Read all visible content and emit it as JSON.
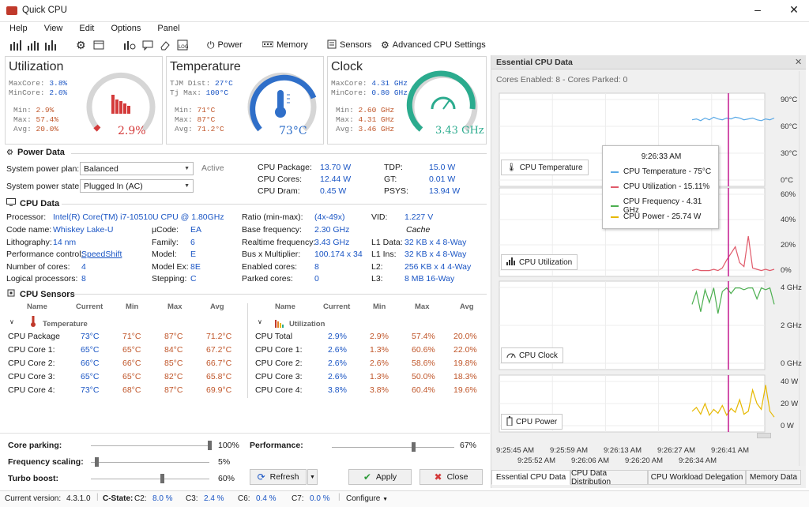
{
  "app": {
    "title": "Quick CPU"
  },
  "menu": [
    "Help",
    "View",
    "Edit",
    "Options",
    "Panel"
  ],
  "toolbar": {
    "power": "Power",
    "memory": "Memory",
    "sensors": "Sensors",
    "advanced": "Advanced CPU Settings"
  },
  "cards": {
    "utilization": {
      "title": "Utilization",
      "rows": [
        [
          "MaxCore:",
          "3.8%"
        ],
        [
          "MinCore:",
          "2.6%"
        ]
      ],
      "stats": [
        [
          "Min:",
          "2.9%"
        ],
        [
          "Max:",
          "57.4%"
        ],
        [
          "Avg:",
          "20.0%"
        ]
      ],
      "value": "2.9%"
    },
    "temperature": {
      "title": "Temperature",
      "rows": [
        [
          "TJM Dist:",
          "27°C"
        ],
        [
          "Tj Max:",
          "100°C"
        ]
      ],
      "stats": [
        [
          "Min:",
          "71°C"
        ],
        [
          "Max:",
          "87°C"
        ],
        [
          "Avg:",
          "71.2°C"
        ]
      ],
      "value": "73°C"
    },
    "clock": {
      "title": "Clock",
      "rows": [
        [
          "MaxCore:",
          "4.31 GHz"
        ],
        [
          "MinCore:",
          "0.80 GHz"
        ]
      ],
      "stats": [
        [
          "Min:",
          "2.60 GHz"
        ],
        [
          "Max:",
          "4.31 GHz"
        ],
        [
          "Avg:",
          "3.46 GHz"
        ]
      ],
      "value": "3.43 GHz"
    }
  },
  "power": {
    "section": "Power Data",
    "plan_label": "System power plan:",
    "plan_value": "Balanced",
    "active": "Active",
    "state_label": "System power state:",
    "state_value": "Plugged In (AC)",
    "metrics": [
      [
        "CPU Package:",
        "13.70 W"
      ],
      [
        "CPU Cores:",
        "12.44 W"
      ],
      [
        "CPU Dram:",
        "0.45 W"
      ]
    ],
    "metrics2": [
      [
        "TDP:",
        "15.0 W"
      ],
      [
        "GT:",
        "0.01 W"
      ],
      [
        "PSYS:",
        "13.94 W"
      ]
    ]
  },
  "cpu": {
    "section": "CPU Data",
    "col1": [
      [
        "Processor:",
        "Intel(R) Core(TM) i7-10510U CPU @ 1.80GHz"
      ],
      [
        "Code name:",
        "Whiskey Lake-U"
      ],
      [
        "Lithography:",
        "14 nm"
      ],
      [
        "Performance control:",
        "SpeedShift"
      ],
      [
        "Number of cores:",
        "4"
      ],
      [
        "Logical processors:",
        "8"
      ]
    ],
    "col2": [
      [
        "µCode:",
        "EA"
      ],
      [
        "Family:",
        "6"
      ],
      [
        "Model:",
        "E"
      ],
      [
        "Model Ex:",
        "8E"
      ],
      [
        "Stepping:",
        "C"
      ]
    ],
    "col3": [
      [
        "Ratio (min-max):",
        "(4x-49x)"
      ],
      [
        "Base frequency:",
        "2.30 GHz"
      ],
      [
        "Realtime frequency:",
        "3.43 GHz"
      ],
      [
        "Bus x Multiplier:",
        "100.174 x 34"
      ],
      [
        "Enabled cores:",
        "8"
      ],
      [
        "Parked cores:",
        "0"
      ]
    ],
    "vid_label": "VID:",
    "vid_value": "1.227 V",
    "cache": "Cache",
    "col4": [
      [
        "L1 Data:",
        "32 KB x 4  8-Way"
      ],
      [
        "L1 Ins:",
        "32 KB x 4  8-Way"
      ],
      [
        "L2:",
        "256 KB x 4  4-Way"
      ],
      [
        "L3:",
        "8 MB  16-Way"
      ]
    ]
  },
  "sensors": {
    "section": "CPU Sensors",
    "headers": [
      "Name",
      "Current",
      "Min",
      "Max",
      "Avg"
    ],
    "temp": {
      "group": "Temperature",
      "rows": [
        [
          "CPU Package",
          "73°C",
          "71°C",
          "87°C",
          "71.2°C"
        ],
        [
          "CPU Core 1:",
          "65°C",
          "65°C",
          "84°C",
          "67.2°C"
        ],
        [
          "CPU Core 2:",
          "66°C",
          "66°C",
          "85°C",
          "66.7°C"
        ],
        [
          "CPU Core 3:",
          "65°C",
          "65°C",
          "82°C",
          "65.8°C"
        ],
        [
          "CPU Core 4:",
          "73°C",
          "68°C",
          "87°C",
          "69.9°C"
        ]
      ]
    },
    "util": {
      "group": "Utilization",
      "rows": [
        [
          "CPU Total",
          "2.9%",
          "2.9%",
          "57.4%",
          "20.0%"
        ],
        [
          "CPU Core 1:",
          "2.6%",
          "1.3%",
          "60.6%",
          "22.0%"
        ],
        [
          "CPU Core 2:",
          "2.6%",
          "2.6%",
          "58.6%",
          "19.8%"
        ],
        [
          "CPU Core 3:",
          "2.6%",
          "1.3%",
          "50.0%",
          "18.3%"
        ],
        [
          "CPU Core 4:",
          "3.8%",
          "3.8%",
          "60.4%",
          "19.6%"
        ]
      ]
    }
  },
  "controls": {
    "core_parking": {
      "label": "Core parking:",
      "value": "100%",
      "level": 1.0
    },
    "freq_scaling": {
      "label": "Frequency scaling:",
      "value": "5%",
      "level": 0.05
    },
    "turbo": {
      "label": "Turbo boost:",
      "value": "60%",
      "level": 0.6
    },
    "performance": {
      "label": "Performance:",
      "value": "67%",
      "level": 0.67
    },
    "refresh": "Refresh",
    "apply": "Apply",
    "close": "Close"
  },
  "panel": {
    "title": "Essential CPU Data",
    "cores": "Cores Enabled: 8 - Cores Parked: 0",
    "tooltip": {
      "time": "9:26:33 AM",
      "items": [
        "CPU Temperature - 75°C",
        "CPU Utilization - 15.11%",
        "CPU Frequency - 4.31 GHz",
        "CPU Power - 25.74 W"
      ],
      "colors": [
        "#5aa9e6",
        "#e05a6a",
        "#4caf50",
        "#e6b800"
      ]
    },
    "labels": [
      "CPU Temperature",
      "CPU Utilization",
      "CPU Clock",
      "CPU Power"
    ],
    "tabs": [
      "Essential CPU Data",
      "CPU Data Distribution",
      "CPU Workload Delegation",
      "Memory Data"
    ]
  },
  "chart_data": {
    "type": "line",
    "x_ticks_top": [
      "9:25:45 AM",
      "9:25:59 AM",
      "9:26:13 AM",
      "9:26:27 AM",
      "9:26:41 AM"
    ],
    "x_ticks_bottom": [
      "9:25:52 AM",
      "9:26:06 AM",
      "9:26:20 AM",
      "9:26:34 AM"
    ],
    "cursor": "9:26:33 AM",
    "panels": [
      {
        "name": "CPU Temperature",
        "yticks": [
          "90°C",
          "60°C",
          "30°C",
          "0°C"
        ],
        "ylim": [
          0,
          100
        ],
        "color": "#5aa9e6",
        "values": [
          73,
          74,
          72,
          75,
          73,
          76,
          74,
          73,
          75,
          74,
          76,
          75,
          73,
          74,
          75,
          73,
          72,
          74,
          73,
          75
        ]
      },
      {
        "name": "CPU Utilization",
        "yticks": [
          "60%",
          "40%",
          "20%",
          "0%"
        ],
        "ylim": [
          0,
          62
        ],
        "color": "#e05a6a",
        "values": [
          2,
          3,
          2,
          2,
          2,
          3,
          2,
          4,
          10,
          15,
          20,
          8,
          5,
          28,
          4,
          3,
          2,
          3,
          2,
          3
        ]
      },
      {
        "name": "CPU Clock",
        "yticks": [
          "4 GHz",
          "2 GHz",
          "0 GHz"
        ],
        "ylim": [
          0,
          4.5
        ],
        "color": "#4caf50",
        "values": [
          3.4,
          4.1,
          3.0,
          4.2,
          3.5,
          4.3,
          2.9,
          4.1,
          4.3,
          4.0,
          4.3,
          4.3,
          4.2,
          4.3,
          4.3,
          3.7,
          4.3,
          4.2,
          4.3,
          3.4
        ]
      },
      {
        "name": "CPU Power",
        "yticks": [
          "40 W",
          "20 W",
          "0 W"
        ],
        "ylim": [
          0,
          52
        ],
        "color": "#e6b800",
        "values": [
          18,
          22,
          15,
          26,
          14,
          20,
          16,
          24,
          14,
          21,
          17,
          30,
          15,
          18,
          40,
          26,
          20,
          45,
          18,
          12
        ]
      }
    ]
  },
  "status": {
    "version_label": "Current version:",
    "version": "4.3.1.0",
    "cstate": "C-State:",
    "c2": "8.0 %",
    "c3": "2.4 %",
    "c6": "0.4 %",
    "c7": "0.0 %",
    "configure": "Configure"
  }
}
